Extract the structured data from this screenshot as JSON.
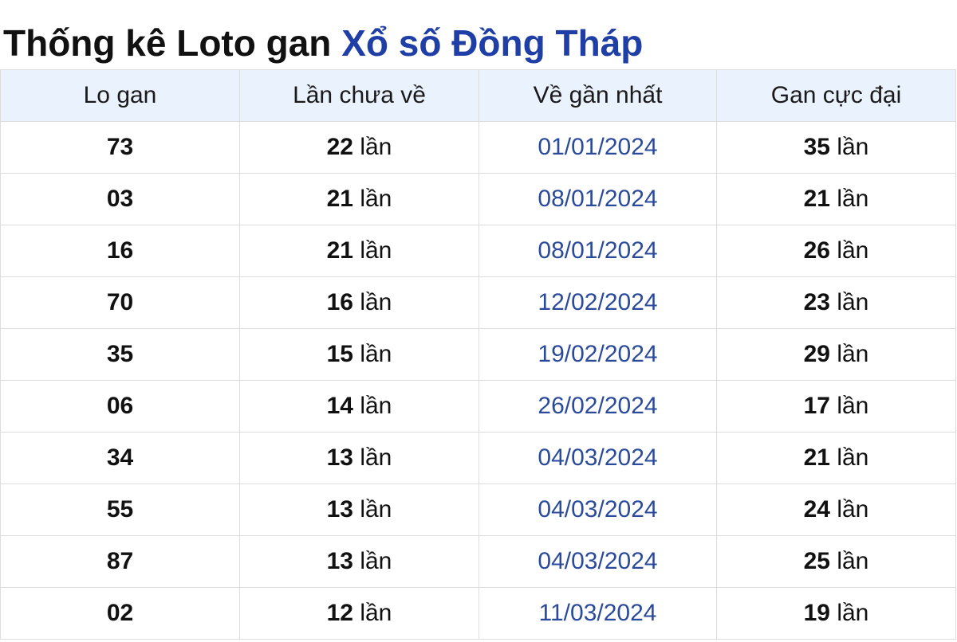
{
  "title": {
    "prefix": "Thống kê Loto gan",
    "link": "Xổ số Đồng Tháp"
  },
  "table": {
    "headers": [
      "Lo gan",
      "Lần chưa về",
      "Về gần nhất",
      "Gan cực đại"
    ],
    "unit": "lần",
    "rows": [
      {
        "lo": "73",
        "chua_ve": "22",
        "ve_gan_nhat": "01/01/2024",
        "gan_cuc_dai": "35"
      },
      {
        "lo": "03",
        "chua_ve": "21",
        "ve_gan_nhat": "08/01/2024",
        "gan_cuc_dai": "21"
      },
      {
        "lo": "16",
        "chua_ve": "21",
        "ve_gan_nhat": "08/01/2024",
        "gan_cuc_dai": "26"
      },
      {
        "lo": "70",
        "chua_ve": "16",
        "ve_gan_nhat": "12/02/2024",
        "gan_cuc_dai": "23"
      },
      {
        "lo": "35",
        "chua_ve": "15",
        "ve_gan_nhat": "19/02/2024",
        "gan_cuc_dai": "29"
      },
      {
        "lo": "06",
        "chua_ve": "14",
        "ve_gan_nhat": "26/02/2024",
        "gan_cuc_dai": "17"
      },
      {
        "lo": "34",
        "chua_ve": "13",
        "ve_gan_nhat": "04/03/2024",
        "gan_cuc_dai": "21"
      },
      {
        "lo": "55",
        "chua_ve": "13",
        "ve_gan_nhat": "04/03/2024",
        "gan_cuc_dai": "24"
      },
      {
        "lo": "87",
        "chua_ve": "13",
        "ve_gan_nhat": "04/03/2024",
        "gan_cuc_dai": "25"
      },
      {
        "lo": "02",
        "chua_ve": "12",
        "ve_gan_nhat": "11/03/2024",
        "gan_cuc_dai": "19"
      }
    ]
  }
}
